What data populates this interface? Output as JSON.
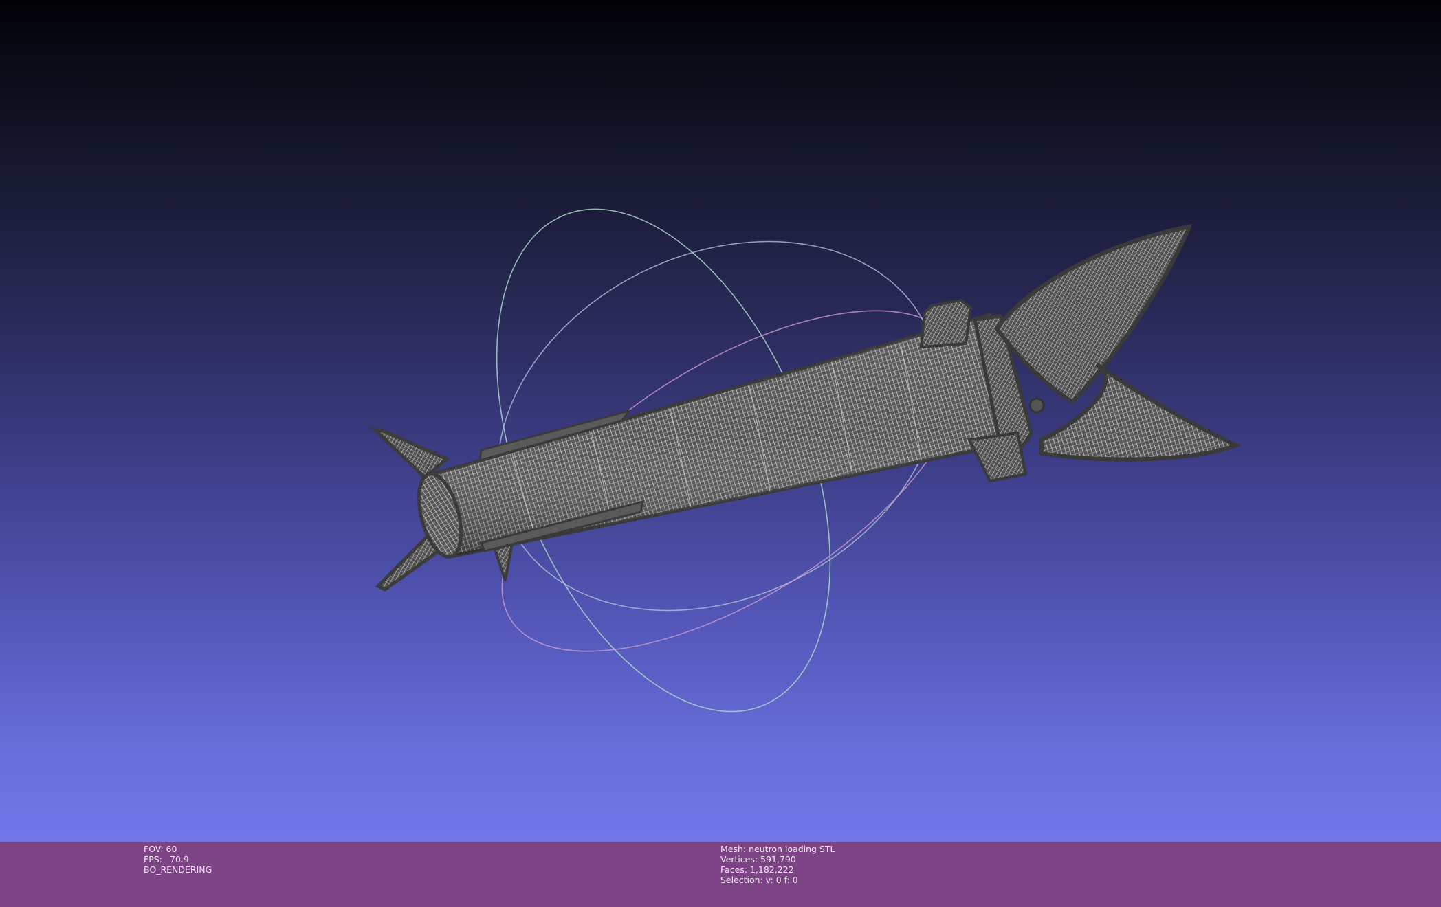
{
  "status_bar": {
    "fov_label": "FOV: 60",
    "fps_label": "FPS:",
    "fps_value": "70.9",
    "render_mode": "BO_RENDERING",
    "mesh_label": "Mesh: neutron loading STL",
    "vertices_label": "Vertices: 591,790",
    "faces_label": "Faces: 1,182,222",
    "selection_label": "Selection: v: 0 f: 0"
  },
  "viewport": {
    "background_top": "#020207",
    "background_bottom": "#7376e8",
    "mesh_color": "#4a4a4a",
    "mesh_line_color": "#d8d8d8",
    "trackball_colors": [
      "#9fb8c8",
      "#c89fc8",
      "#a0d0c0"
    ]
  }
}
